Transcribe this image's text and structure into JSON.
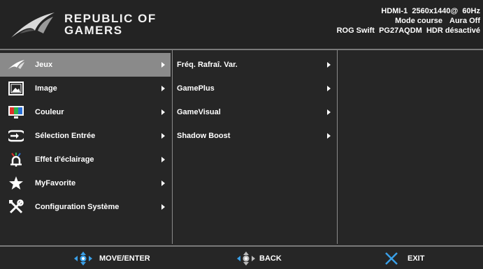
{
  "header": {
    "brand_line1": "REPUBLIC OF",
    "brand_line2": "GAMERS",
    "status": {
      "input": "HDMI-1",
      "resolution": "2560x1440@",
      "refresh": "60Hz",
      "mode": "Mode course",
      "aura": "Aura Off",
      "model_name": "ROG Swift",
      "model_number": "PG27AQDM",
      "hdr": "HDR désactivé"
    }
  },
  "main_menu": {
    "items": [
      {
        "label": "Jeux",
        "icon": "rog-eye-icon",
        "selected": true
      },
      {
        "label": "Image",
        "icon": "image-icon",
        "selected": false
      },
      {
        "label": "Couleur",
        "icon": "color-icon",
        "selected": false
      },
      {
        "label": "Sélection Entrée",
        "icon": "input-select-icon",
        "selected": false
      },
      {
        "label": "Effet d'éclairage",
        "icon": "lighting-effect-icon",
        "selected": false
      },
      {
        "label": "MyFavorite",
        "icon": "star-icon",
        "selected": false
      },
      {
        "label": "Configuration Système",
        "icon": "wrench-screwdriver-icon",
        "selected": false
      }
    ]
  },
  "sub_menu": {
    "items": [
      {
        "label": "Fréq. Rafraî. Var."
      },
      {
        "label": "GamePlus"
      },
      {
        "label": "GameVisual"
      },
      {
        "label": "Shadow Boost"
      }
    ]
  },
  "footer": {
    "move_enter": "MOVE/ENTER",
    "back": "BACK",
    "exit": "EXIT"
  },
  "colors": {
    "background": "#262626",
    "selected": "#8a8a8a",
    "accent_blue": "#3aa0e8",
    "divider": "#8a8a8a"
  }
}
